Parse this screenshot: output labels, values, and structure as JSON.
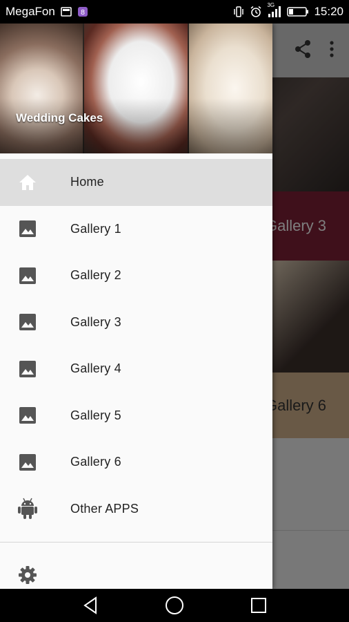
{
  "status_bar": {
    "carrier": "MegaFon",
    "network_type": "3G",
    "time": "15:20",
    "icons": [
      "image-notification-icon",
      "app-notification-icon",
      "vibrate-icon",
      "alarm-icon",
      "signal-icon",
      "battery-icon"
    ]
  },
  "drawer": {
    "header_title": "Wedding Cakes",
    "items": [
      {
        "label": "Home",
        "icon": "home-icon",
        "selected": true
      },
      {
        "label": "Gallery 1",
        "icon": "image-icon"
      },
      {
        "label": "Gallery 2",
        "icon": "image-icon"
      },
      {
        "label": "Gallery 3",
        "icon": "image-icon"
      },
      {
        "label": "Gallery 4",
        "icon": "image-icon"
      },
      {
        "label": "Gallery 5",
        "icon": "image-icon"
      },
      {
        "label": "Gallery 6",
        "icon": "image-icon"
      },
      {
        "label": "Other APPS",
        "icon": "android-icon"
      }
    ],
    "footer_icon": "settings-icon"
  },
  "background": {
    "toolbar_icons": [
      "share-icon",
      "more-vert-icon"
    ],
    "tiles": [
      {
        "label": "Gallery 3",
        "color": "#7a1f35"
      },
      {
        "label": "Gallery 6",
        "color": "#c9ab86"
      }
    ]
  },
  "nav_bar": {
    "buttons": [
      "back-icon",
      "home-circle-icon",
      "recents-icon"
    ]
  }
}
